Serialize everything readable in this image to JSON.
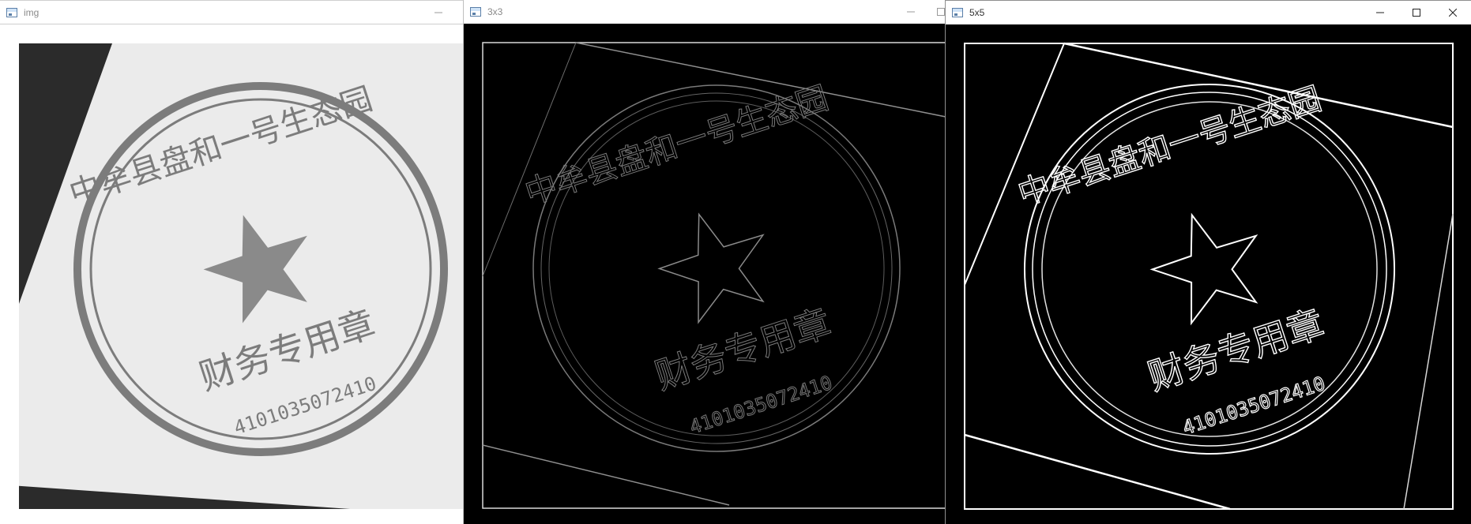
{
  "windows": [
    {
      "title": "img",
      "state": "inactive",
      "controls": [
        "minimize-icon"
      ],
      "image": {
        "kind": "grayscale scanned stamp on white paper",
        "stamp_text": {
          "ring": "中牟县盘和一号生态园",
          "center": "财务专用章",
          "number": "4101035072410"
        }
      }
    },
    {
      "title": "3x3",
      "state": "inactive",
      "controls": [
        "minimize-icon",
        "maximize-icon"
      ],
      "image": {
        "kind": "faint edge-detected stamp on black",
        "stamp_text": {
          "ring": "中牟县盘和一号生态园",
          "center": "财务专用章",
          "number": "4101035072410"
        }
      }
    },
    {
      "title": "5x5",
      "state": "active",
      "controls": [
        "minimize-icon",
        "maximize-icon",
        "close-icon"
      ],
      "image": {
        "kind": "strong edge-detected stamp on black",
        "stamp_text": {
          "ring": "中牟县盘和一号生态园",
          "center": "财务专用章",
          "number": "4101035072410"
        }
      }
    }
  ],
  "colors": {
    "window_background": "#ffffff",
    "paper": "#ebebeb",
    "dark_background": "#000000",
    "stamp_ink": "#7c7c7c",
    "edge_faint": "#7a7a7a",
    "edge_strong": "#ffffff"
  }
}
